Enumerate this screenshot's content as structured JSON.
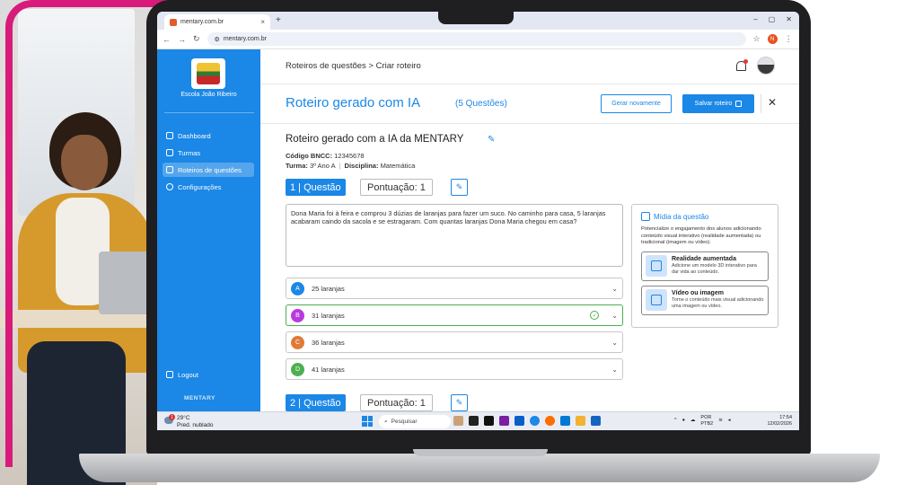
{
  "browser": {
    "tab_title": "mentary.com.br",
    "url": "mentary.com.br",
    "profile_initial": "N"
  },
  "sidebar": {
    "school_name": "Escola João Ribeiro",
    "items": [
      {
        "label": "Dashboard",
        "icon": "chart-icon"
      },
      {
        "label": "Turmas",
        "icon": "users-icon"
      },
      {
        "label": "Roteiros de questões",
        "icon": "list-icon",
        "active": true
      },
      {
        "label": "Configurações",
        "icon": "gear-icon"
      }
    ],
    "logout_label": "Logout",
    "brand": "MENTARY"
  },
  "header": {
    "breadcrumb": "Roteiros de questões > Criar roteiro"
  },
  "page": {
    "title": "Roteiro gerado com IA",
    "count": "(5 Questões)",
    "regenerate_label": "Gerar novamente",
    "save_label": "Salvar roteiro"
  },
  "roteiro": {
    "title": "Roteiro gerado com a IA da MENTARY",
    "bncc_label": "Código BNCC:",
    "bncc_value": "12345678",
    "turma_label": "Turma:",
    "turma_value": "3º Ano A",
    "disciplina_label": "Disciplina:",
    "disciplina_value": "Matemática"
  },
  "questions": [
    {
      "badge": "1 | Questão",
      "points": "Pontuação: 1",
      "text": "Dona Maria foi à feira e comprou 3 dúzias de laranjas para fazer um suco. No caminho para casa, 5 laranjas acabaram caindo da sacola e se estragaram. Com quantas laranjas Dona Maria chegou em casa?",
      "options": [
        {
          "letter": "A",
          "text": "25 laranjas",
          "color": "#1b87e6"
        },
        {
          "letter": "B",
          "text": "31 laranjas",
          "color": "#b93be0",
          "correct": true
        },
        {
          "letter": "C",
          "text": "36 laranjas",
          "color": "#e07a36"
        },
        {
          "letter": "D",
          "text": "41 laranjas",
          "color": "#4caf50"
        }
      ]
    },
    {
      "badge": "2 | Questão",
      "points": "Pontuação: 1"
    }
  ],
  "media": {
    "title": "Mídia da questão",
    "description": "Potencialize o engajamento dos alunos adicionando conteúdo visual interativo (realidade aumentada) ou tradicional (imagem ou vídeo).",
    "cards": [
      {
        "title": "Realidade aumentada",
        "desc": "Adicione um modelo 3D interativo para dar vida ao conteúdo."
      },
      {
        "title": "Vídeo ou imagem",
        "desc": "Torne o conteúdo mais visual adicionando uma imagem ou vídeo."
      }
    ]
  },
  "taskbar": {
    "weather_temp": "29°C",
    "weather_desc": "Pred. nublado",
    "weather_badge": "1",
    "search_label": "Pesquisar",
    "lang1": "POR",
    "lang2": "PTB2",
    "time": "17:54",
    "date": "12/02/2026"
  }
}
